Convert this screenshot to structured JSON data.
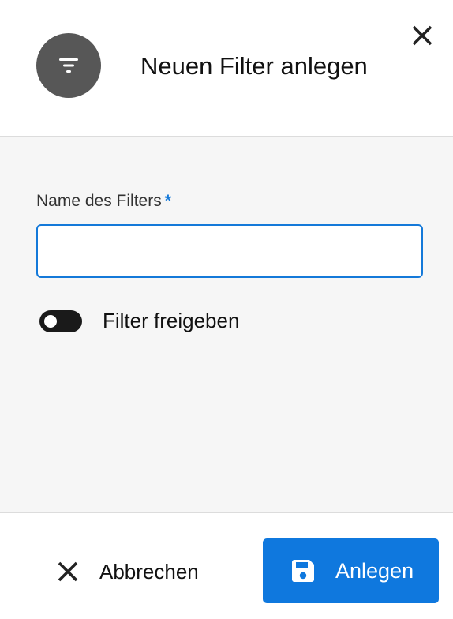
{
  "header": {
    "icon": "filter-icon",
    "title": "Neuen Filter anlegen",
    "close_icon": "close-icon",
    "icon_bg_color": "#575757"
  },
  "form": {
    "name_label": "Name des Filters",
    "required_mark": "*",
    "name_value": "",
    "toggle_label": "Filter freigeben",
    "toggle_on": false,
    "accent_color": "#1479d9"
  },
  "footer": {
    "cancel_label": "Abbrechen",
    "cancel_icon": "close-icon",
    "create_label": "Anlegen",
    "create_icon": "save-icon",
    "create_color": "#0f78de"
  }
}
